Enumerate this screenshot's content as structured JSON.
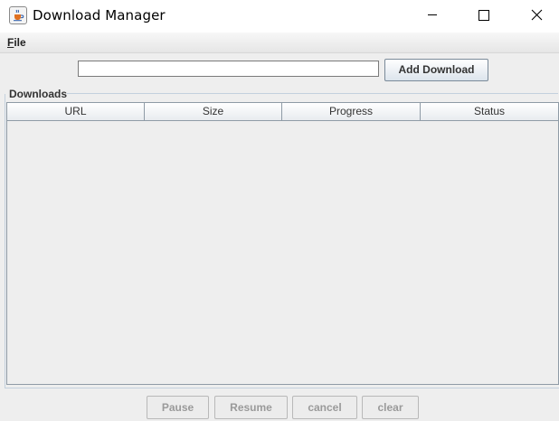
{
  "window": {
    "title": "Download Manager",
    "icon": "java-cup-icon"
  },
  "menu": {
    "file_mnemonic": "F",
    "file_rest": "ile"
  },
  "toolbar": {
    "url_value": "",
    "add_label": "Add Download"
  },
  "downloads": {
    "group_title": "Downloads",
    "columns": [
      "URL",
      "Size",
      "Progress",
      "Status"
    ],
    "rows": []
  },
  "actions": {
    "pause_label": "Pause",
    "resume_label": "Resume",
    "cancel_label": "cancel",
    "clear_label": "clear"
  }
}
